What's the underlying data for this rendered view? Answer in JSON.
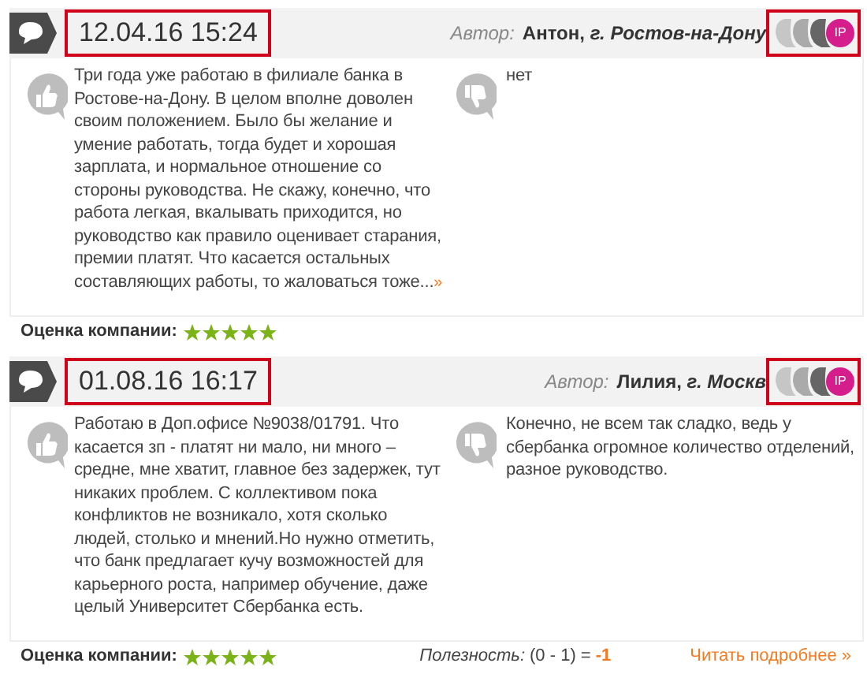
{
  "reviews": [
    {
      "date": "12.04.16 15:24",
      "author_label": "Автор:",
      "author": "Антон, *г. Ростов-на-Дону*",
      "badge": "IP",
      "pros": "Три года уже работаю в филиале банка в Ростове-на-Дону. В целом вполне доволен своим положением. Было бы желание и умение работать, тогда будет и хорошая зарплата, и нормальное отношение со стороны руководства. Не скажу, конечно, что работа легкая, вкалывать приходится, но руководство как правило оценивает старания, премии платят. Что касается остальных составляющих работы, то жаловаться тоже...",
      "more_link": "»",
      "cons": "нет",
      "rating_label": "Оценка компании:",
      "stars": 5
    },
    {
      "date": "01.08.16 16:17",
      "author_label": "Автор:",
      "author": "Лилия, *г. Москв*",
      "badge": "IP",
      "pros": "Работаю в Доп.офисе №9038/01791. Что касается зп - платят ни мало, ни много – средне, мне хватит, главное без задержек, тут никаких проблем. С коллективом пока конфликтов не возникало, хотя сколько людей, столько и мнений.Но нужно отметить, что банк предлагает кучу возможностей для карьерного роста, например обучение, даже целый Университет Сбербанка есть.",
      "cons": "Конечно, не всем так сладко, ведь у сбербанка огромное количество отделений, разное руководство.",
      "rating_label": "Оценка компании:",
      "stars": 5,
      "usefulness_label": "Полезность:",
      "usefulness_formula": "(0 - 1) =",
      "usefulness_value": "-1",
      "read_more": "Читать подробнее »"
    }
  ]
}
